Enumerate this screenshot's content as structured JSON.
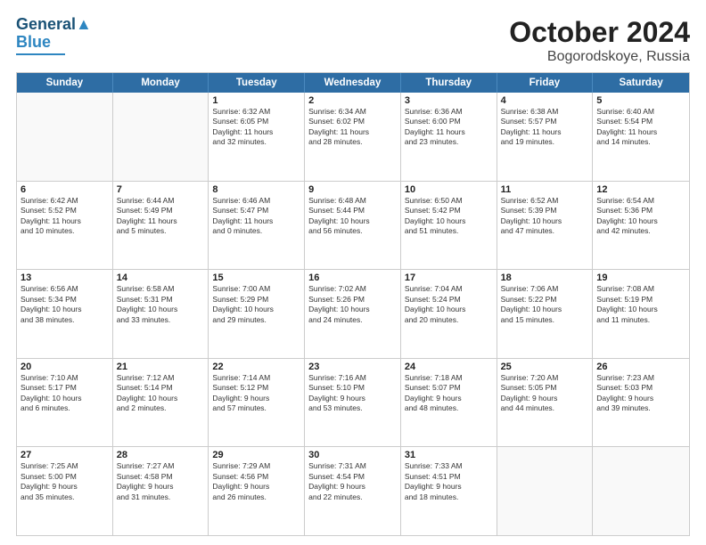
{
  "header": {
    "logo_line1": "General",
    "logo_line2": "Blue",
    "title": "October 2024",
    "subtitle": "Bogorodskoye, Russia"
  },
  "weekdays": [
    "Sunday",
    "Monday",
    "Tuesday",
    "Wednesday",
    "Thursday",
    "Friday",
    "Saturday"
  ],
  "weeks": [
    [
      {
        "day": "",
        "lines": [],
        "empty": true
      },
      {
        "day": "",
        "lines": [],
        "empty": true
      },
      {
        "day": "1",
        "lines": [
          "Sunrise: 6:32 AM",
          "Sunset: 6:05 PM",
          "Daylight: 11 hours",
          "and 32 minutes."
        ]
      },
      {
        "day": "2",
        "lines": [
          "Sunrise: 6:34 AM",
          "Sunset: 6:02 PM",
          "Daylight: 11 hours",
          "and 28 minutes."
        ]
      },
      {
        "day": "3",
        "lines": [
          "Sunrise: 6:36 AM",
          "Sunset: 6:00 PM",
          "Daylight: 11 hours",
          "and 23 minutes."
        ]
      },
      {
        "day": "4",
        "lines": [
          "Sunrise: 6:38 AM",
          "Sunset: 5:57 PM",
          "Daylight: 11 hours",
          "and 19 minutes."
        ]
      },
      {
        "day": "5",
        "lines": [
          "Sunrise: 6:40 AM",
          "Sunset: 5:54 PM",
          "Daylight: 11 hours",
          "and 14 minutes."
        ]
      }
    ],
    [
      {
        "day": "6",
        "lines": [
          "Sunrise: 6:42 AM",
          "Sunset: 5:52 PM",
          "Daylight: 11 hours",
          "and 10 minutes."
        ]
      },
      {
        "day": "7",
        "lines": [
          "Sunrise: 6:44 AM",
          "Sunset: 5:49 PM",
          "Daylight: 11 hours",
          "and 5 minutes."
        ]
      },
      {
        "day": "8",
        "lines": [
          "Sunrise: 6:46 AM",
          "Sunset: 5:47 PM",
          "Daylight: 11 hours",
          "and 0 minutes."
        ]
      },
      {
        "day": "9",
        "lines": [
          "Sunrise: 6:48 AM",
          "Sunset: 5:44 PM",
          "Daylight: 10 hours",
          "and 56 minutes."
        ]
      },
      {
        "day": "10",
        "lines": [
          "Sunrise: 6:50 AM",
          "Sunset: 5:42 PM",
          "Daylight: 10 hours",
          "and 51 minutes."
        ]
      },
      {
        "day": "11",
        "lines": [
          "Sunrise: 6:52 AM",
          "Sunset: 5:39 PM",
          "Daylight: 10 hours",
          "and 47 minutes."
        ]
      },
      {
        "day": "12",
        "lines": [
          "Sunrise: 6:54 AM",
          "Sunset: 5:36 PM",
          "Daylight: 10 hours",
          "and 42 minutes."
        ]
      }
    ],
    [
      {
        "day": "13",
        "lines": [
          "Sunrise: 6:56 AM",
          "Sunset: 5:34 PM",
          "Daylight: 10 hours",
          "and 38 minutes."
        ]
      },
      {
        "day": "14",
        "lines": [
          "Sunrise: 6:58 AM",
          "Sunset: 5:31 PM",
          "Daylight: 10 hours",
          "and 33 minutes."
        ]
      },
      {
        "day": "15",
        "lines": [
          "Sunrise: 7:00 AM",
          "Sunset: 5:29 PM",
          "Daylight: 10 hours",
          "and 29 minutes."
        ]
      },
      {
        "day": "16",
        "lines": [
          "Sunrise: 7:02 AM",
          "Sunset: 5:26 PM",
          "Daylight: 10 hours",
          "and 24 minutes."
        ]
      },
      {
        "day": "17",
        "lines": [
          "Sunrise: 7:04 AM",
          "Sunset: 5:24 PM",
          "Daylight: 10 hours",
          "and 20 minutes."
        ]
      },
      {
        "day": "18",
        "lines": [
          "Sunrise: 7:06 AM",
          "Sunset: 5:22 PM",
          "Daylight: 10 hours",
          "and 15 minutes."
        ]
      },
      {
        "day": "19",
        "lines": [
          "Sunrise: 7:08 AM",
          "Sunset: 5:19 PM",
          "Daylight: 10 hours",
          "and 11 minutes."
        ]
      }
    ],
    [
      {
        "day": "20",
        "lines": [
          "Sunrise: 7:10 AM",
          "Sunset: 5:17 PM",
          "Daylight: 10 hours",
          "and 6 minutes."
        ]
      },
      {
        "day": "21",
        "lines": [
          "Sunrise: 7:12 AM",
          "Sunset: 5:14 PM",
          "Daylight: 10 hours",
          "and 2 minutes."
        ]
      },
      {
        "day": "22",
        "lines": [
          "Sunrise: 7:14 AM",
          "Sunset: 5:12 PM",
          "Daylight: 9 hours",
          "and 57 minutes."
        ]
      },
      {
        "day": "23",
        "lines": [
          "Sunrise: 7:16 AM",
          "Sunset: 5:10 PM",
          "Daylight: 9 hours",
          "and 53 minutes."
        ]
      },
      {
        "day": "24",
        "lines": [
          "Sunrise: 7:18 AM",
          "Sunset: 5:07 PM",
          "Daylight: 9 hours",
          "and 48 minutes."
        ]
      },
      {
        "day": "25",
        "lines": [
          "Sunrise: 7:20 AM",
          "Sunset: 5:05 PM",
          "Daylight: 9 hours",
          "and 44 minutes."
        ]
      },
      {
        "day": "26",
        "lines": [
          "Sunrise: 7:23 AM",
          "Sunset: 5:03 PM",
          "Daylight: 9 hours",
          "and 39 minutes."
        ]
      }
    ],
    [
      {
        "day": "27",
        "lines": [
          "Sunrise: 7:25 AM",
          "Sunset: 5:00 PM",
          "Daylight: 9 hours",
          "and 35 minutes."
        ]
      },
      {
        "day": "28",
        "lines": [
          "Sunrise: 7:27 AM",
          "Sunset: 4:58 PM",
          "Daylight: 9 hours",
          "and 31 minutes."
        ]
      },
      {
        "day": "29",
        "lines": [
          "Sunrise: 7:29 AM",
          "Sunset: 4:56 PM",
          "Daylight: 9 hours",
          "and 26 minutes."
        ]
      },
      {
        "day": "30",
        "lines": [
          "Sunrise: 7:31 AM",
          "Sunset: 4:54 PM",
          "Daylight: 9 hours",
          "and 22 minutes."
        ]
      },
      {
        "day": "31",
        "lines": [
          "Sunrise: 7:33 AM",
          "Sunset: 4:51 PM",
          "Daylight: 9 hours",
          "and 18 minutes."
        ]
      },
      {
        "day": "",
        "lines": [],
        "empty": true
      },
      {
        "day": "",
        "lines": [],
        "empty": true
      }
    ]
  ]
}
